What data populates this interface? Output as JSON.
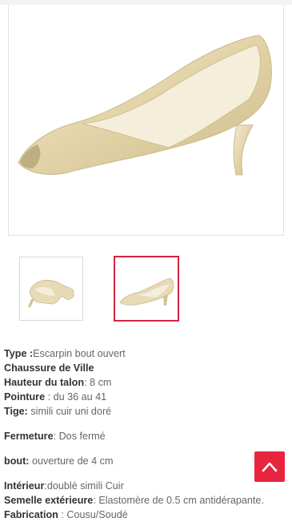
{
  "specs": {
    "type_label": "Type :",
    "type_value": "Escarpin bout ouvert",
    "category": "Chaussure de Ville",
    "heel_label": "Hauteur du talon",
    "heel_value": ": 8 cm",
    "size_label": "Pointure",
    "size_value": " : du 36 au 41",
    "upper_label": "Tige:",
    "upper_value": " simili cuir  uni doré",
    "closure_label": "Fermeture",
    "closure_value": ": Dos fermé",
    "toe_label": "bout:",
    "toe_value": " ouverture de 4 cm",
    "lining_label": "Intérieur",
    "lining_value": ":doublé simili Cuir",
    "sole_label": "Semelle extérieure",
    "sole_value": ": Elastomère de 0.5 cm antidérapante.",
    "make_label": "Fabrication",
    "make_value": " : Cousu/Soudé"
  },
  "colors": {
    "accent": "#e8243f",
    "shoe_gold": "#e6d9b4"
  },
  "icons": {
    "scroll_top": "chevron-up-icon"
  }
}
